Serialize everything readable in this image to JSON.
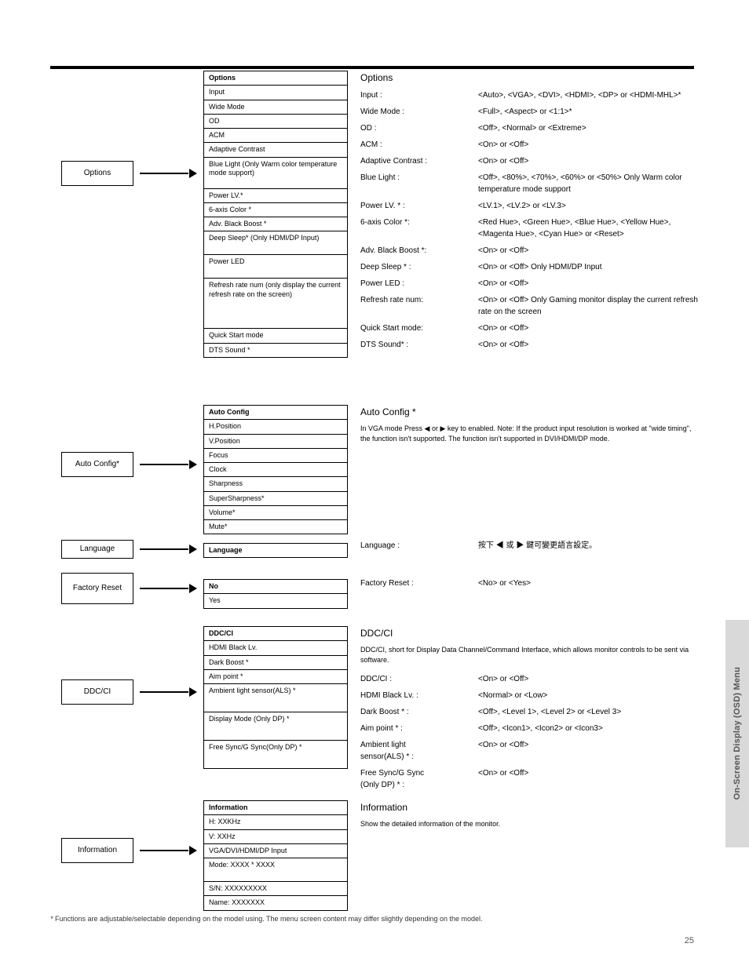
{
  "sideTab": "On-Screen Display (OSD) Menu",
  "pageNumber": "25",
  "footnote": "Functions are adjustable/selectable depending on the model using. The menu screen content may differ slightly depending on the model.",
  "groups": [
    {
      "label": "Options",
      "descTitle": "Options",
      "menu": [
        "Options",
        "Input",
        "Wide Mode",
        "OD",
        "ACM",
        "Adaptive Contrast",
        "Blue Light (Only Warm color temperature mode support)",
        "Power LV.*",
        "6-axis Color *",
        "Adv. Black Boost *",
        "Deep Sleep* (Only HDMI/DP Input)",
        "Power LED",
        "Refresh rate num (only display the current refresh rate on the screen)",
        "Quick Start mode",
        "DTS Sound *"
      ],
      "desc": [
        {
          "k": "Input :",
          "v": "<Auto>, <VGA>, <DVI>, <HDMI>, <DP> or <HDMI-MHL>*"
        },
        {
          "k": "Wide Mode :",
          "v": "<Full>, <Aspect> or <1:1>*"
        },
        {
          "k": "OD :",
          "v": "<Off>, <Normal> or <Extreme>"
        },
        {
          "k": "ACM :",
          "v": "<On> or <Off>"
        },
        {
          "k": "Adaptive Contrast :",
          "v": "<On> or <Off>"
        },
        {
          "k": "Blue Light :",
          "v": "<Off>, <80%>, <70%>, <60%> or <50%> Only Warm color temperature mode support"
        },
        {
          "k": "Power LV. * :",
          "v": "<LV.1>, <LV.2> or <LV.3>"
        },
        {
          "k": "6-axis Color *:",
          "v": "<Red Hue>, <Green Hue>, <Blue Hue>, <Yellow Hue>, <Magenta Hue>, <Cyan Hue> or <Reset>"
        },
        {
          "k": "Adv. Black Boost *:",
          "v": "<On> or <Off>"
        },
        {
          "k": "Deep Sleep * :",
          "v": "<On> or <Off> Only HDMI/DP Input"
        },
        {
          "k": "Power LED :",
          "v": "<On> or <Off>"
        },
        {
          "k": "Refresh rate num:",
          "v": "<On> or <Off> Only Gaming monitor display the current refresh rate on the screen"
        },
        {
          "k": "Quick Start mode:",
          "v": "<On> or <Off>"
        },
        {
          "k": "DTS Sound* :",
          "v": "<On> or <Off>"
        }
      ]
    },
    {
      "label": "Auto Config*",
      "descTitle": "Auto Config *",
      "note": "In VGA mode Press ◀ or ▶ key to enabled. Note: If the product input resolution is worked at \"wide timing\", the function isn't supported. The function isn't supported in DVI/HDMI/DP mode.",
      "menu": [
        "Auto Config",
        "H.Position",
        "V.Position",
        "Focus",
        "Clock",
        "Sharpness",
        "SuperSharpness*",
        "Volume*",
        "Mute*"
      ]
    },
    {
      "label": "Language",
      "menu": [
        "Language"
      ],
      "desc": [
        {
          "k": "Language :",
          "v": "按下 ◀ 或 ▶ 鍵可變更語言設定。"
        }
      ]
    },
    {
      "label": "Factory Reset",
      "menu": [
        "No",
        "Yes"
      ],
      "desc": [
        {
          "k": "Factory Reset :",
          "v": "<No> or <Yes>"
        }
      ]
    },
    {
      "label": "DDC/CI",
      "descTitle": "DDC/CI",
      "note": "DDC/CI, short for Display Data Channel/Command Interface, which allows monitor controls to be sent via software.",
      "menu": [
        "DDC/CI",
        "HDMI Black Lv.",
        "Dark Boost *",
        "Aim point *",
        "Ambient light sensor(ALS) *",
        "Display Mode (Only DP) *",
        "Free Sync/G Sync(Only DP) *"
      ],
      "desc": [
        {
          "k": "DDC/CI :",
          "v": "<On> or <Off>"
        },
        {
          "k": "HDMI Black Lv. :",
          "v": "<Normal> or <Low>"
        },
        {
          "k": "Dark Boost * :",
          "v": "<Off>, <Level 1>, <Level 2> or <Level 3>"
        },
        {
          "k": "Aim point * :",
          "v": "<Off>, <Icon1>, <Icon2> or <Icon3>"
        },
        {
          "k": "Ambient light \nsensor(ALS) * :",
          "v": "<On> or <Off>"
        },
        {
          "k": "Free Sync/G Sync \n(Only DP) * :",
          "v": "<On> or <Off>"
        }
      ]
    },
    {
      "label": "Information",
      "descTitle": "Information",
      "note": "Show the detailed information of the monitor.",
      "menu": [
        "Information",
        "H: XXKHz",
        "V: XXHz",
        "VGA/DVI/HDMI/DP Input",
        "Mode: XXXX * XXXX",
        "S/N: XXXXXXXXX",
        "Name: XXXXXXX"
      ]
    }
  ]
}
